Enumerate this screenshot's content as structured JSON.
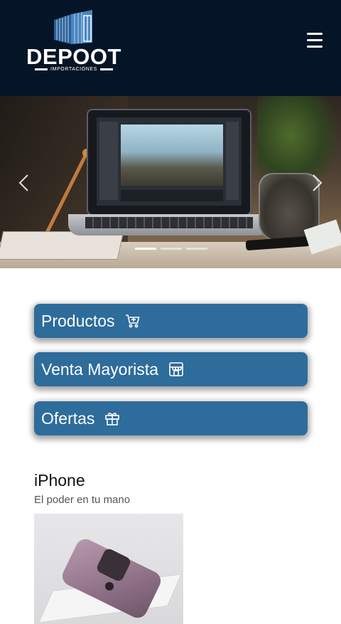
{
  "header": {
    "logo_text": "DEPOOT",
    "logo_subtext": "IMPORTACIONES",
    "menu_icon": "hamburger-menu-icon"
  },
  "carousel": {
    "slide_count": 3,
    "active_slide": 1,
    "prev_icon": "chevron-left-icon",
    "next_icon": "chevron-right-icon"
  },
  "categories": [
    {
      "label": "Productos",
      "icon": "cart-plus-icon"
    },
    {
      "label": "Venta Mayorista",
      "icon": "store-icon"
    },
    {
      "label": "Ofertas",
      "icon": "gift-icon"
    }
  ],
  "featured": {
    "title": "iPhone",
    "subtitle": "El poder en tu mano"
  },
  "colors": {
    "header_bg": "#061427",
    "button_bg": "#2e6c9c",
    "button_text": "#ffffff"
  }
}
